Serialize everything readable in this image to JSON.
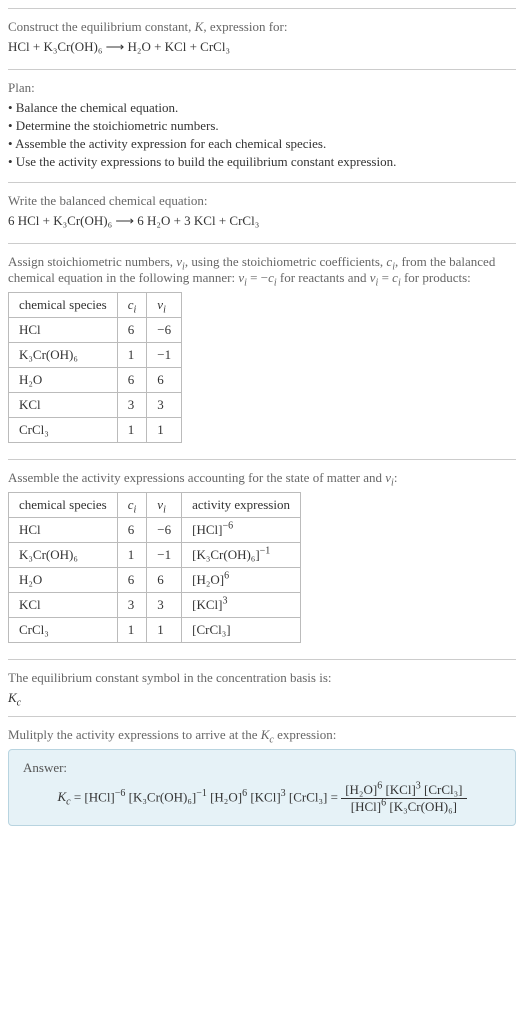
{
  "header": {
    "prompt": "Construct the equilibrium constant, K, expression for:",
    "equation": "HCl + K₃Cr(OH)₆ ⟶ H₂O + KCl + CrCl₃"
  },
  "plan": {
    "title": "Plan:",
    "items": [
      "• Balance the chemical equation.",
      "• Determine the stoichiometric numbers.",
      "• Assemble the activity expression for each chemical species.",
      "• Use the activity expressions to build the equilibrium constant expression."
    ]
  },
  "balanced": {
    "prompt": "Write the balanced chemical equation:",
    "equation": "6 HCl + K₃Cr(OH)₆ ⟶ 6 H₂O + 3 KCl + CrCl₃"
  },
  "stoich": {
    "intro": "Assign stoichiometric numbers, νᵢ, using the stoichiometric coefficients, cᵢ, from the balanced chemical equation in the following manner: νᵢ = −cᵢ for reactants and νᵢ = cᵢ for products:",
    "headers": [
      "chemical species",
      "cᵢ",
      "νᵢ"
    ],
    "rows": [
      {
        "sp": "HCl",
        "c": "6",
        "v": "−6"
      },
      {
        "sp": "K₃Cr(OH)₆",
        "c": "1",
        "v": "−1"
      },
      {
        "sp": "H₂O",
        "c": "6",
        "v": "6"
      },
      {
        "sp": "KCl",
        "c": "3",
        "v": "3"
      },
      {
        "sp": "CrCl₃",
        "c": "1",
        "v": "1"
      }
    ]
  },
  "activity": {
    "intro": "Assemble the activity expressions accounting for the state of matter and νᵢ:",
    "headers": [
      "chemical species",
      "cᵢ",
      "νᵢ",
      "activity expression"
    ],
    "rows": [
      {
        "sp": "HCl",
        "c": "6",
        "v": "−6",
        "a_base": "[HCl]",
        "a_exp": "−6"
      },
      {
        "sp": "K₃Cr(OH)₆",
        "c": "1",
        "v": "−1",
        "a_base": "[K₃Cr(OH)₆]",
        "a_exp": "−1"
      },
      {
        "sp": "H₂O",
        "c": "6",
        "v": "6",
        "a_base": "[H₂O]",
        "a_exp": "6"
      },
      {
        "sp": "KCl",
        "c": "3",
        "v": "3",
        "a_base": "[KCl]",
        "a_exp": "3"
      },
      {
        "sp": "CrCl₃",
        "c": "1",
        "v": "1",
        "a_base": "[CrCl₃]",
        "a_exp": ""
      }
    ]
  },
  "kc_symbol": {
    "prompt": "The equilibrium constant symbol in the concentration basis is:",
    "value": "K_c"
  },
  "multiply": {
    "prompt": "Mulitply the activity expressions to arrive at the K_c expression:"
  },
  "answer": {
    "label": "Answer:",
    "lhs": "K_c =",
    "flat": "[HCl]⁻⁶ [K₃Cr(OH)₆]⁻¹ [H₂O]⁶ [KCl]³ [CrCl₃] =",
    "num": "[H₂O]⁶ [KCl]³ [CrCl₃]",
    "den": "[HCl]⁶ [K₃Cr(OH)₆]"
  }
}
